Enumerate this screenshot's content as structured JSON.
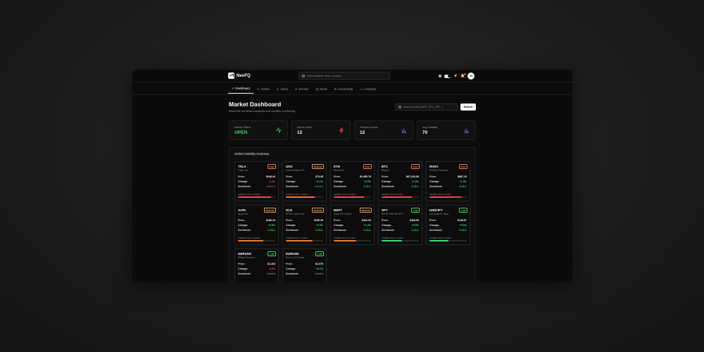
{
  "brand": {
    "name": "NeoFQ"
  },
  "top": {
    "search_placeholder": "Search assets, news, or topics...",
    "notif_count": "3",
    "avatar": "JC"
  },
  "nav": [
    {
      "label": "Dashboard",
      "icon": "trend-icon",
      "glyph": "↗"
    },
    {
      "label": "Assets",
      "icon": "asset-icon",
      "glyph": "⊘"
    },
    {
      "label": "Alpha",
      "icon": "alpha-icon",
      "glyph": "◎"
    },
    {
      "label": "Monitor",
      "icon": "monitor-icon",
      "glyph": "⊕"
    },
    {
      "label": "News",
      "icon": "news-icon",
      "glyph": "▤"
    },
    {
      "label": "Social Data",
      "icon": "social-icon",
      "glyph": "⊞"
    },
    {
      "label": "Calendar",
      "icon": "calendar-icon",
      "glyph": "▭"
    }
  ],
  "header": {
    "title": "Market Dashboard",
    "subtitle": "Real-time sentiment analysis and volatility monitoring",
    "search_placeholder": "Search assets (AAPL, BTC, SPY...)",
    "search_button": "Search"
  },
  "stats": [
    {
      "label": "Market Status",
      "value": "OPEN",
      "icon": "activity-icon",
      "color": "#3ddc6a"
    },
    {
      "label": "Active Alerts",
      "value": "12",
      "icon": "bolt-icon",
      "color": "#ef4b4b"
    },
    {
      "label": "Tracked Assets",
      "value": "12",
      "icon": "bar-chart-icon",
      "color": "#7c6cf0"
    },
    {
      "label": "Avg Volatility",
      "value": "70",
      "icon": "bar-chart-icon",
      "color": "#7c6cf0"
    }
  ],
  "heatmap": {
    "title": "Global Volatility Heatmap",
    "labels": {
      "price": "Price:",
      "change": "Change:",
      "sentiment": "Sentiment:"
    },
    "assets": [
      {
        "symbol": "TSLA",
        "name": "Tesla, Inc.",
        "risk": "HIGH",
        "price": "$248.42",
        "change": "-3.4%",
        "dir": "neg",
        "sentiment": "Bearish",
        "score_text": "Volatility Score: 89/100",
        "score": 0.89,
        "bar_color": "#ef4b4b"
      },
      {
        "symbol": "USO",
        "name": "United States Oil ...",
        "risk": "MEDIUM",
        "price": "$73.45",
        "change": "+2.1%",
        "dir": "pos",
        "sentiment": "Neutral",
        "score_text": "Volatility Score: 78/100",
        "score": 0.78,
        "bar_color": "#f07a2b"
      },
      {
        "symbol": "ETH",
        "name": "Ethereum",
        "risk": "HIGH",
        "price": "$1,456.78",
        "change": "+2.9%",
        "dir": "pos",
        "sentiment": "Bullish",
        "score_text": "Volatility Score: 82/100",
        "score": 0.82,
        "bar_color": "#ef4b4b"
      },
      {
        "symbol": "BTC",
        "name": "Bitcoin",
        "risk": "HIGH",
        "price": "$67,234.56",
        "change": "+1.9%",
        "dir": "pos",
        "sentiment": "Bullish",
        "score_text": "Volatility Score: 81/100",
        "score": 0.81,
        "bar_color": "#ef4b4b"
      },
      {
        "symbol": "NVDA",
        "name": "NVIDIA Corporati...",
        "risk": "HIGH",
        "price": "$887.23",
        "change": "+1.9%",
        "dir": "pos",
        "sentiment": "Bullish",
        "score_text": "Volatility Score: 84/100",
        "score": 0.84,
        "bar_color": "#ef4b4b"
      },
      {
        "symbol": "AAPL",
        "name": "Apple Inc.",
        "risk": "MEDIUM",
        "price": "$185.44",
        "change": "+0.8%",
        "dir": "pos",
        "sentiment": "Bullish",
        "score_text": "Volatility Score: 68/100",
        "score": 0.68,
        "bar_color": "#f07a2b"
      },
      {
        "symbol": "GLD",
        "name": "SPDR Gold Trust",
        "risk": "MEDIUM",
        "price": "$195.45",
        "change": "+0.3%",
        "dir": "pos",
        "sentiment": "Bullish",
        "score_text": "Volatility Score: 72/100",
        "score": 0.72,
        "bar_color": "#f07a2b"
      },
      {
        "symbol": "MSFT",
        "name": "Microsoft Corpor...",
        "risk": "MEDIUM",
        "price": "$432.34",
        "change": "+1.4%",
        "dir": "pos",
        "sentiment": "Bullish",
        "score_text": "Volatility Score: 61/100",
        "score": 0.61,
        "bar_color": "#f07a2b"
      },
      {
        "symbol": "SPY",
        "name": "SPDR S&P 500 ETF",
        "risk": "LOW",
        "price": "$428.93",
        "change": "+0.5%",
        "dir": "pos",
        "sentiment": "Bullish",
        "score_text": "Volatility Score: 54/100",
        "score": 0.54,
        "bar_color": "#3ddc6a"
      },
      {
        "symbol": "USD/JPY",
        "name": "US Dollar to Japa...",
        "risk": "LOW",
        "price": "$149.87",
        "change": "+0.5%",
        "dir": "pos",
        "sentiment": "Bullish",
        "score_text": "Volatility Score: 50/100",
        "score": 0.5,
        "bar_color": "#3ddc6a"
      },
      {
        "symbol": "GBPUSD",
        "name": "British Pound to ...",
        "risk": "LOW",
        "price": "$1.263",
        "change": "-0.3%",
        "dir": "neg",
        "sentiment": "Neutral",
        "score_text": "",
        "score": 0,
        "bar_color": "#3ddc6a"
      },
      {
        "symbol": "EURUSD",
        "name": "Euro to US Dollar",
        "risk": "LOW",
        "price": "$1.075",
        "change": "+0.1%",
        "dir": "pos",
        "sentiment": "Neutral",
        "score_text": "",
        "score": 0,
        "bar_color": "#3ddc6a"
      }
    ]
  }
}
